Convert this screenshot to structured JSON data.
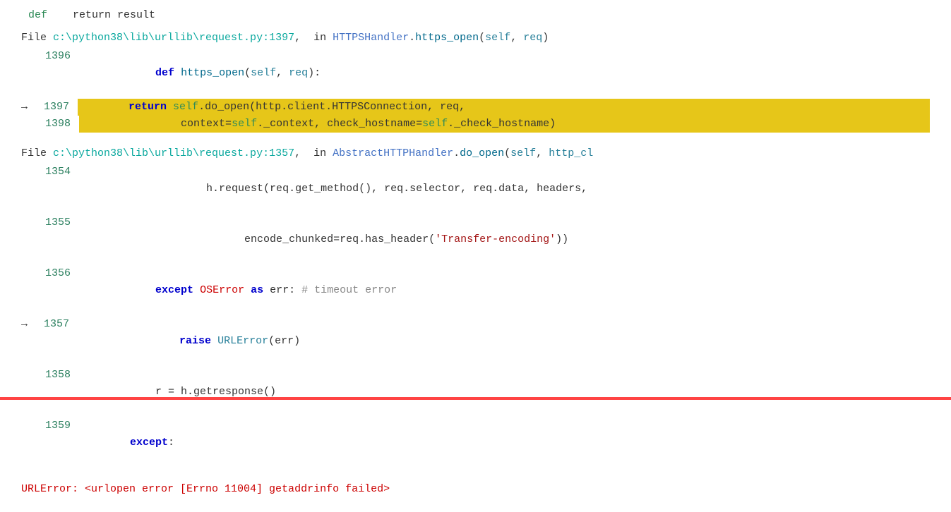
{
  "top_hint": "    return result",
  "block1": {
    "file_line": "File c:\\python38\\lib\\urllib\\request.py:1397,  in HTTPSHandler.https_open(self, req)",
    "lines": [
      {
        "num": "1396",
        "arrow": "",
        "highlighted": false,
        "content": "def https_open(self, req):"
      },
      {
        "num": "1397",
        "arrow": "→",
        "highlighted": true,
        "content": "    return self.do_open(http.client.HTTPSConnection, req,"
      },
      {
        "num": "1398",
        "arrow": "",
        "highlighted": true,
        "content": "                context=self._context, check_hostname=self._check_hostname)"
      }
    ]
  },
  "block2": {
    "file_line": "File c:\\python38\\lib\\urllib\\request.py:1357,  in AbstractHTTPHandler.do_open(self, http_cl",
    "lines": [
      {
        "num": "1354",
        "arrow": "",
        "highlighted": false,
        "content": "        h.request(req.get_method(), req.selector, req.data, headers,"
      },
      {
        "num": "1355",
        "arrow": "",
        "highlighted": false,
        "content": "                  encode_chunked=req.has_header('Transfer-encoding'))"
      },
      {
        "num": "1356",
        "arrow": "",
        "highlighted": false,
        "content": "    except OSError as err: # timeout error"
      },
      {
        "num": "1357",
        "arrow": "→",
        "highlighted": false,
        "content": "        raise URLError(err)"
      },
      {
        "num": "1358",
        "arrow": "",
        "highlighted": false,
        "content": "    r = h.getresponse()"
      },
      {
        "num": "1359",
        "arrow": "",
        "highlighted": false,
        "content": "except:"
      }
    ]
  },
  "error_text": "URLError: <urlopen error [Errno 11004] getaddrinfo failed>"
}
